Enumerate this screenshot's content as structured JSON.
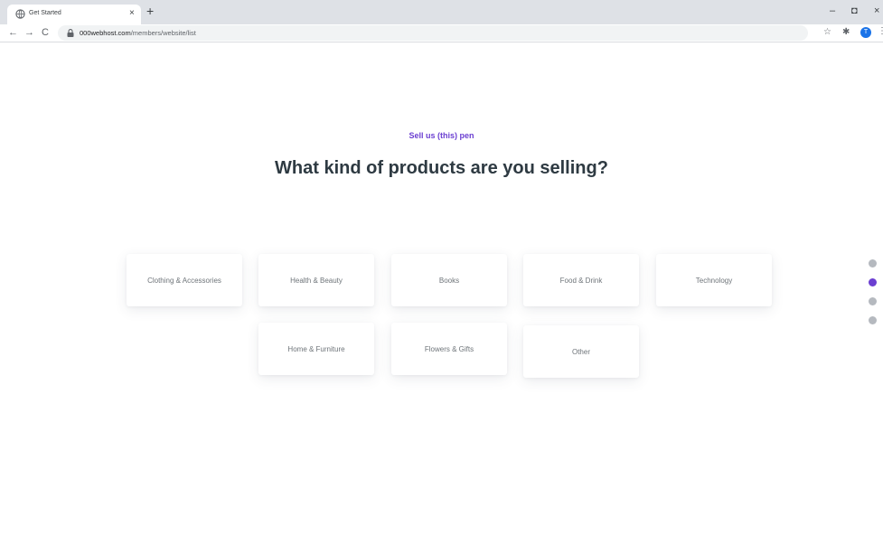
{
  "browser": {
    "tab_title": "Get Started",
    "tab_close": "×",
    "new_tab": "+",
    "url_host": "000webhost.com",
    "url_path": "/members/website/list",
    "back": "←",
    "forward": "→",
    "reload": "C",
    "star": "☆",
    "extensions": "✱",
    "avatar_initial": "T",
    "minimize": "–",
    "restore": "◘",
    "close": "×"
  },
  "page": {
    "eyebrow": "Sell us (this) pen",
    "heading": "What kind of products are you selling?",
    "categories": [
      "Clothing & Accessories",
      "Health & Beauty",
      "Books",
      "Food & Drink",
      "Technology",
      "Home & Furniture",
      "Flowers & Gifts",
      "Other"
    ]
  },
  "steps": {
    "total": 4,
    "active": 2
  },
  "colors": {
    "accent": "#6b3fd1",
    "heading": "#2e3a42",
    "inactive_dot": "#b5b9bf"
  }
}
